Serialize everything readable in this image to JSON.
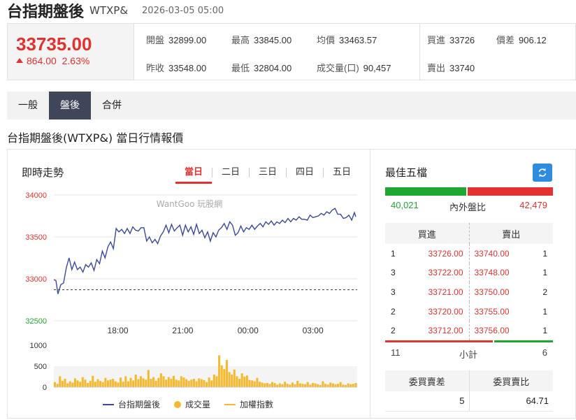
{
  "header": {
    "name": "台指期盤後",
    "code": "WTXP&",
    "time": "2026-03-05 05:00"
  },
  "quote": {
    "price": "33735.00",
    "change": "864.00",
    "change_pct": "2.63%",
    "fields": [
      {
        "label": "開盤",
        "value": "32899.00"
      },
      {
        "label": "最高",
        "value": "33845.00"
      },
      {
        "label": "均價",
        "value": "33463.57"
      },
      {
        "label": "買進",
        "value": "33726"
      },
      {
        "label": "價差",
        "value": "906.12"
      },
      {
        "label": "昨收",
        "value": "33548.00"
      },
      {
        "label": "最低",
        "value": "32804.00"
      },
      {
        "label": "成交量(口)",
        "value": "90,457"
      },
      {
        "label": "賣出",
        "value": "33740"
      }
    ]
  },
  "tabs": [
    {
      "label": "一般"
    },
    {
      "label": "盤後"
    },
    {
      "label": "合併"
    }
  ],
  "section_title": "台指期盤後(WTXP&) 當日行情報價",
  "chart_panel": {
    "title": "即時走勢",
    "ranges": [
      "當日",
      "二日",
      "三日",
      "四日",
      "五日"
    ],
    "watermark": "WantGoo 玩股網",
    "legend": {
      "price": "台指期盤後",
      "volume": "成交量",
      "index": "加權指數"
    }
  },
  "colors": {
    "up": "#e2312f",
    "down": "#1fa830",
    "price_line": "#3b4a9b",
    "volume": "#f5b92f",
    "active_tab": "#40465a",
    "refresh": "#2d8be0"
  },
  "chart_data": [
    {
      "type": "line",
      "x_ticks": [
        "18:00",
        "21:00",
        "00:00",
        "03:00"
      ],
      "y_ticks": [
        34000,
        33500,
        33000,
        32500
      ],
      "ylim": [
        32500,
        34000
      ],
      "reference_line": 32870,
      "series": [
        {
          "name": "台指期盤後",
          "x": [
            0,
            3,
            6,
            10,
            14,
            18,
            22,
            26,
            30,
            34,
            38,
            42,
            46,
            50,
            54,
            58,
            62,
            66,
            70,
            74,
            78,
            82,
            86,
            90,
            94,
            98,
            102,
            106,
            110,
            114,
            118,
            122,
            126,
            130,
            134,
            138,
            142,
            146,
            150,
            154,
            158,
            162,
            166,
            170,
            174,
            178,
            182,
            186,
            190,
            194,
            198,
            202,
            206,
            210,
            214,
            218,
            222,
            226,
            230,
            234,
            238,
            242,
            246,
            250,
            254,
            258,
            262,
            266,
            270,
            274,
            278,
            282,
            286,
            290,
            294,
            298,
            302,
            306,
            310,
            314,
            318,
            322,
            326,
            330,
            334,
            338,
            342,
            346,
            350,
            354,
            358,
            362,
            366,
            370,
            374,
            378,
            382,
            386,
            390,
            394,
            398,
            402,
            406,
            410,
            414,
            418,
            422,
            426,
            430,
            434,
            436
          ],
          "y": [
            32990,
            32980,
            32820,
            32930,
            32950,
            33130,
            33250,
            33110,
            33200,
            33110,
            33140,
            33080,
            33170,
            33140,
            33190,
            33100,
            33230,
            33180,
            33330,
            33250,
            33380,
            33440,
            33360,
            33600,
            33560,
            33590,
            33540,
            33600,
            33540,
            33620,
            33580,
            33570,
            33610,
            33610,
            33450,
            33500,
            33430,
            33470,
            33420,
            33510,
            33560,
            33640,
            33550,
            33650,
            33570,
            33610,
            33640,
            33520,
            33640,
            33560,
            33620,
            33530,
            33650,
            33540,
            33580,
            33490,
            33560,
            33450,
            33550,
            33500,
            33580,
            33610,
            33660,
            33590,
            33680,
            33640,
            33520,
            33550,
            33630,
            33560,
            33610,
            33590,
            33640,
            33590,
            33630,
            33660,
            33620,
            33680,
            33650,
            33690,
            33640,
            33680,
            33660,
            33700,
            33670,
            33720,
            33680,
            33720,
            33700,
            33740,
            33710,
            33710,
            33700,
            33760,
            33730,
            33740,
            33750,
            33780,
            33760,
            33800,
            33780,
            33820,
            33840,
            33770,
            33770,
            33720,
            33730,
            33760,
            33700,
            33790,
            33740
          ]
        }
      ],
      "volume": {
        "name": "成交量",
        "y_ticks": [
          1000,
          500,
          0
        ],
        "ylim": [
          0,
          1000
        ],
        "values": [
          120,
          80,
          260,
          150,
          200,
          90,
          140,
          110,
          210,
          160,
          130,
          240,
          180,
          100,
          150,
          270,
          130,
          190,
          150,
          120,
          220,
          160,
          180,
          200,
          140,
          110,
          230,
          130,
          260,
          140,
          220,
          160,
          300,
          190,
          260,
          210,
          180,
          410,
          200,
          240,
          150,
          220,
          330,
          260,
          180,
          240,
          200,
          270,
          180,
          160,
          260,
          230,
          190,
          150,
          180,
          200,
          140,
          210,
          190,
          170,
          120,
          230,
          160,
          300,
          260,
          760,
          520,
          430,
          650,
          360,
          300,
          420,
          260,
          200,
          330,
          250,
          280,
          170,
          160,
          140,
          220,
          130,
          110,
          90,
          100,
          80,
          120,
          100,
          60,
          90,
          70,
          130,
          80,
          60,
          110,
          70,
          150,
          90,
          80,
          70,
          120,
          60,
          100,
          90,
          70,
          50,
          140,
          80,
          60,
          110,
          90,
          70,
          80,
          120,
          60,
          50,
          90,
          70,
          80,
          100
        ]
      }
    },
    {
      "type": "bar",
      "title": "內外盤比",
      "categories": [
        "內盤",
        "外盤"
      ],
      "values": [
        40021,
        42479
      ]
    }
  ],
  "order_book": {
    "title": "最佳五檔",
    "inner": "40,021",
    "inner_outer_label": "內外盤比",
    "outer": "42,479",
    "bid_header": "買進",
    "ask_header": "賣出",
    "rows": [
      {
        "bid_qty": "1",
        "bid": "33726.00",
        "ask": "33740.00",
        "ask_qty": "1"
      },
      {
        "bid_qty": "3",
        "bid": "33722.00",
        "ask": "33748.00",
        "ask_qty": "1"
      },
      {
        "bid_qty": "3",
        "bid": "33721.00",
        "ask": "33750.00",
        "ask_qty": "2"
      },
      {
        "bid_qty": "2",
        "bid": "33720.00",
        "ask": "33755.00",
        "ask_qty": "1"
      },
      {
        "bid_qty": "2",
        "bid": "33712.00",
        "ask": "33756.00",
        "ask_qty": "1"
      }
    ],
    "subtotal_label": "小計",
    "subtotal_bid": "11",
    "subtotal_ask": "6",
    "diff_header": "委買賣差",
    "ratio_header": "委買賣比",
    "diff_value": "5",
    "ratio_value": "64.71"
  }
}
